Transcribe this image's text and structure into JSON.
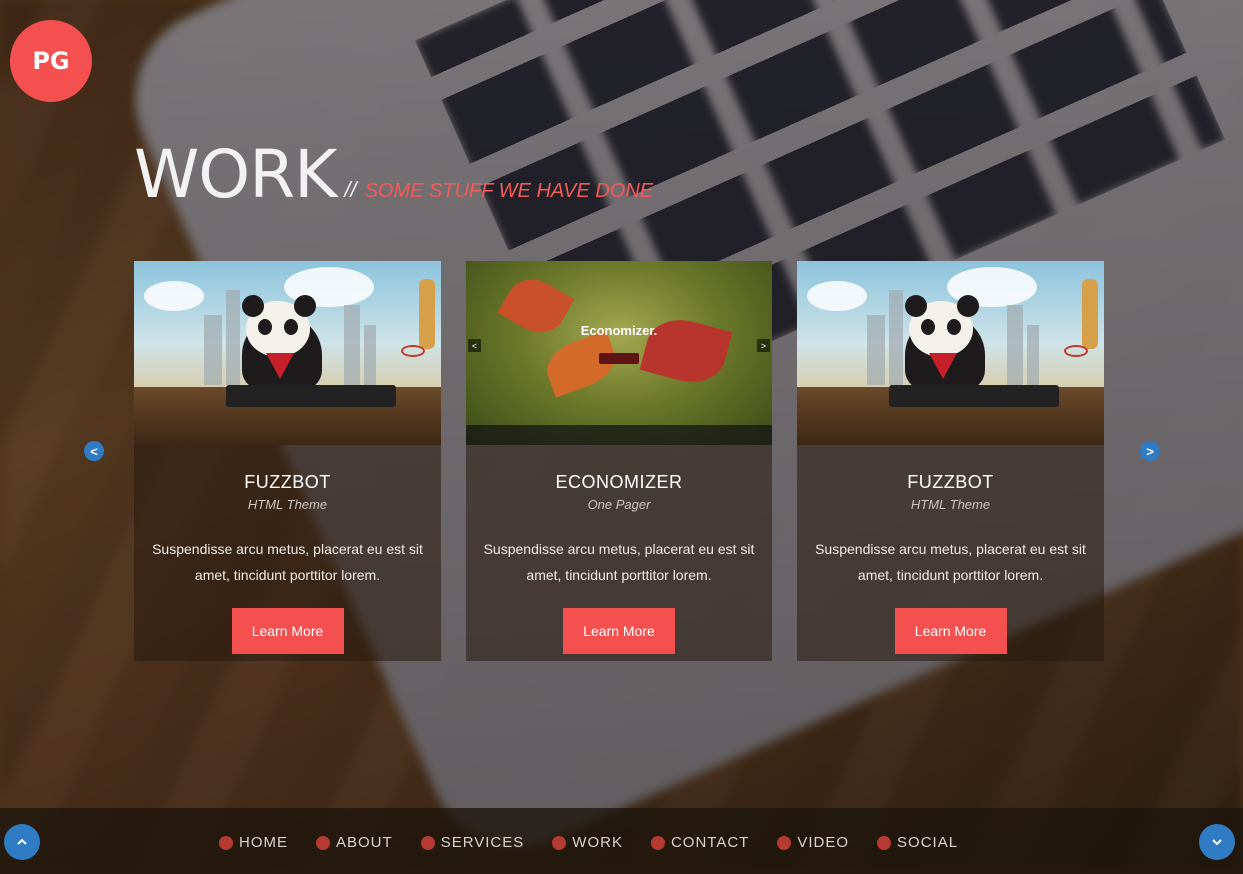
{
  "logo": {
    "text": "PG"
  },
  "section": {
    "title": "WORK",
    "separator": "//",
    "subtitle": "SOME STUFF WE HAVE DONE"
  },
  "carousel": {
    "prev_label": "<",
    "next_label": ">",
    "cards": [
      {
        "title": "FUZZBOT",
        "subtitle": "HTML Theme",
        "description": "Suspendisse arcu metus, placerat eu est sit amet, tincidunt porttitor lorem.",
        "button": "Learn More"
      },
      {
        "title": "ECONOMIZER",
        "subtitle": "One Pager",
        "description": "Suspendisse arcu metus, placerat eu est sit amet, tincidunt porttitor lorem.",
        "button": "Learn More",
        "thumb_title": "Economizer."
      },
      {
        "title": "FUZZBOT",
        "subtitle": "HTML Theme",
        "description": "Suspendisse arcu metus, placerat eu est sit amet, tincidunt porttitor lorem.",
        "button": "Learn More"
      }
    ]
  },
  "nav": {
    "items": [
      {
        "label": "HOME"
      },
      {
        "label": "ABOUT"
      },
      {
        "label": "SERVICES"
      },
      {
        "label": "WORK"
      },
      {
        "label": "CONTACT"
      },
      {
        "label": "VIDEO"
      },
      {
        "label": "SOCIAL"
      }
    ]
  },
  "icons": {
    "scroll_up": "chevron-up-icon",
    "scroll_down": "chevron-down-icon"
  },
  "colors": {
    "accent": "#f45050",
    "blue": "#2f7bc4",
    "nav_dot": "#b43a32"
  }
}
